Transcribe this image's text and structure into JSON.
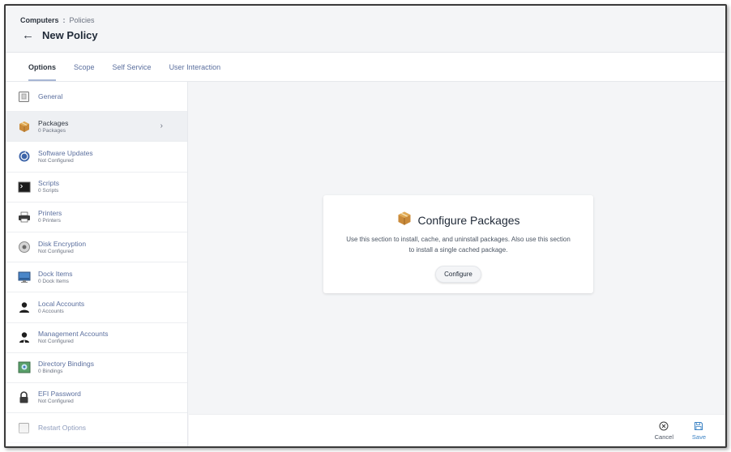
{
  "breadcrumb": {
    "root": "Computers",
    "separator": ":",
    "leaf": "Policies"
  },
  "page": {
    "title": "New Policy"
  },
  "tabs": [
    {
      "label": "Options",
      "active": true
    },
    {
      "label": "Scope",
      "active": false
    },
    {
      "label": "Self Service",
      "active": false
    },
    {
      "label": "User Interaction",
      "active": false
    }
  ],
  "sidebar": {
    "items": [
      {
        "label": "General",
        "sub": "",
        "icon": "general-icon"
      },
      {
        "label": "Packages",
        "sub": "0 Packages",
        "icon": "package-icon",
        "selected": true
      },
      {
        "label": "Software Updates",
        "sub": "Not Configured",
        "icon": "software-update-icon"
      },
      {
        "label": "Scripts",
        "sub": "0 Scripts",
        "icon": "terminal-icon"
      },
      {
        "label": "Printers",
        "sub": "0 Printers",
        "icon": "printer-icon"
      },
      {
        "label": "Disk Encryption",
        "sub": "Not Configured",
        "icon": "disk-icon"
      },
      {
        "label": "Dock Items",
        "sub": "0 Dock Items",
        "icon": "monitor-icon"
      },
      {
        "label": "Local Accounts",
        "sub": "0 Accounts",
        "icon": "user-icon"
      },
      {
        "label": "Management Accounts",
        "sub": "Not Configured",
        "icon": "admin-user-icon"
      },
      {
        "label": "Directory Bindings",
        "sub": "0 Bindings",
        "icon": "directory-icon"
      },
      {
        "label": "EFI Password",
        "sub": "Not Configured",
        "icon": "lock-icon"
      },
      {
        "label": "Restart Options",
        "sub": "",
        "icon": "restart-icon"
      }
    ]
  },
  "card": {
    "title": "Configure Packages",
    "description_line1": "Use this section to install, cache, and uninstall packages. Also use this section",
    "description_line2": "to install a single cached package.",
    "button": "Configure"
  },
  "footer": {
    "cancel": "Cancel",
    "save": "Save"
  },
  "colors": {
    "link": "#5b6f9e",
    "save": "#3b82c4",
    "background": "#f4f5f7"
  }
}
